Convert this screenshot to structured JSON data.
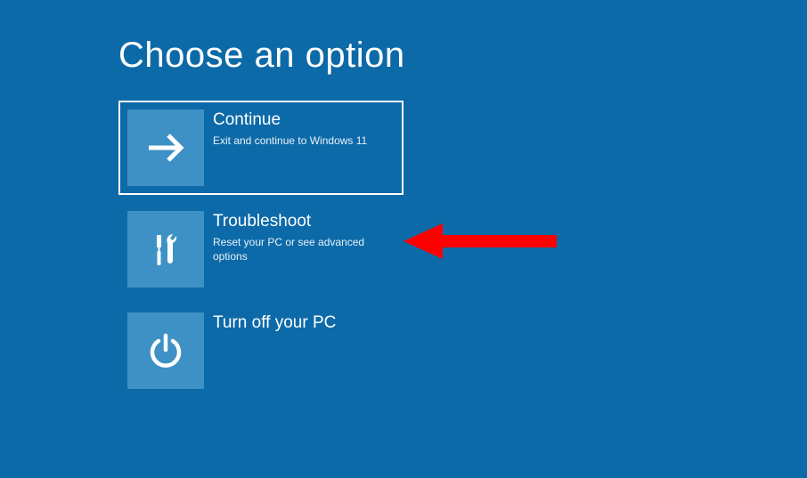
{
  "page": {
    "title": "Choose an option"
  },
  "options": {
    "continue": {
      "title": "Continue",
      "description": "Exit and continue to Windows 11"
    },
    "troubleshoot": {
      "title": "Troubleshoot",
      "description": "Reset your PC or see advanced options"
    },
    "turnoff": {
      "title": "Turn off your PC",
      "description": ""
    }
  }
}
